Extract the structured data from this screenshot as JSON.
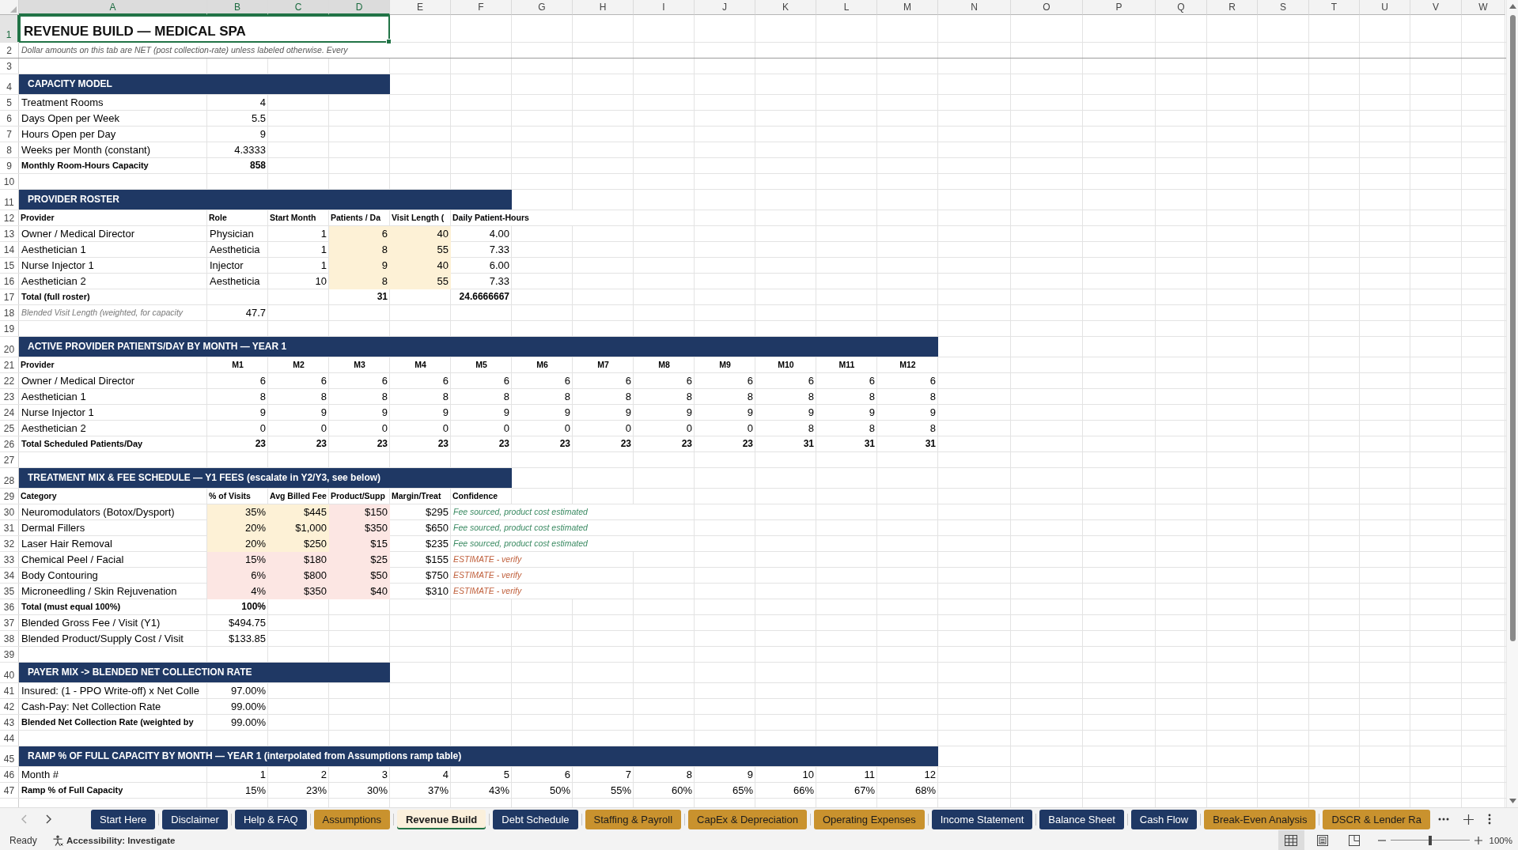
{
  "column_headers": [
    {
      "label": "A",
      "selected": true
    },
    {
      "label": "B",
      "selected": true
    },
    {
      "label": "C",
      "selected": true
    },
    {
      "label": "D",
      "selected": true
    },
    {
      "label": "E",
      "selected": false
    },
    {
      "label": "F",
      "selected": false
    },
    {
      "label": "G",
      "selected": false
    },
    {
      "label": "H",
      "selected": false
    },
    {
      "label": "I",
      "selected": false
    },
    {
      "label": "J",
      "selected": false
    },
    {
      "label": "K",
      "selected": false
    },
    {
      "label": "L",
      "selected": false
    },
    {
      "label": "M",
      "selected": false
    },
    {
      "label": "N",
      "selected": false
    },
    {
      "label": "O",
      "selected": false
    },
    {
      "label": "P",
      "selected": false
    },
    {
      "label": "Q",
      "selected": false
    },
    {
      "label": "R",
      "selected": false
    },
    {
      "label": "S",
      "selected": false
    },
    {
      "label": "T",
      "selected": false
    },
    {
      "label": "U",
      "selected": false
    },
    {
      "label": "V",
      "selected": false
    },
    {
      "label": "W",
      "selected": false
    }
  ],
  "rows": [
    {
      "number": "1",
      "selected": true,
      "kind": "title",
      "cells": [
        "REVENUE BUILD — MEDICAL SPA"
      ]
    },
    {
      "number": "2",
      "selected": false,
      "kind": "note",
      "cells": [
        "Dollar amounts on this tab are NET (post collection-rate) unless labeled otherwise. Every"
      ]
    },
    {
      "number": "3",
      "selected": false,
      "kind": "blank"
    },
    {
      "number": "4",
      "selected": false,
      "kind": "section",
      "cells": [
        "CAPACITY MODEL"
      ]
    },
    {
      "number": "5",
      "selected": false,
      "kind": "data",
      "cells": [
        "Treatment Rooms",
        "4"
      ]
    },
    {
      "number": "6",
      "selected": false,
      "kind": "data",
      "cells": [
        "Days Open per Week",
        "5.5"
      ]
    },
    {
      "number": "7",
      "selected": false,
      "kind": "data",
      "cells": [
        "Hours Open per Day",
        "9"
      ]
    },
    {
      "number": "8",
      "selected": false,
      "kind": "data",
      "cells": [
        "Weeks per Month (constant)",
        "4.3333"
      ]
    },
    {
      "number": "9",
      "selected": false,
      "kind": "total",
      "cells": [
        "Monthly Room-Hours Capacity",
        "858"
      ]
    },
    {
      "number": "10",
      "selected": false,
      "kind": "blank"
    },
    {
      "number": "11",
      "selected": false,
      "kind": "section",
      "cells": [
        "PROVIDER ROSTER"
      ]
    },
    {
      "number": "12",
      "selected": false,
      "kind": "header",
      "cells": [
        "Provider",
        "Role",
        "Start Month",
        "Patients / Da",
        "Visit Length (",
        "Daily Patient-Hours"
      ]
    },
    {
      "number": "13",
      "selected": false,
      "kind": "roster",
      "cells": [
        "Owner / Medical Director",
        "Physician",
        "1",
        "6",
        "40",
        "4.00"
      ]
    },
    {
      "number": "14",
      "selected": false,
      "kind": "roster",
      "cells": [
        "Aesthetician 1",
        "Aestheticia",
        "1",
        "8",
        "55",
        "7.33"
      ]
    },
    {
      "number": "15",
      "selected": false,
      "kind": "roster",
      "cells": [
        "Nurse Injector 1",
        "Injector",
        "1",
        "9",
        "40",
        "6.00"
      ]
    },
    {
      "number": "16",
      "selected": false,
      "kind": "roster",
      "cells": [
        "Aesthetician 2",
        "Aestheticia",
        "10",
        "8",
        "55",
        "7.33"
      ]
    },
    {
      "number": "17",
      "selected": false,
      "kind": "total",
      "cells": [
        "Total (full roster)",
        null,
        null,
        "31",
        null,
        "24.6666667"
      ]
    },
    {
      "number": "18",
      "selected": false,
      "kind": "aside",
      "cells": [
        "Blended Visit Length (weighted, for capacity",
        "47.7"
      ]
    },
    {
      "number": "19",
      "selected": false,
      "kind": "blank"
    },
    {
      "number": "20",
      "selected": false,
      "kind": "section",
      "cells": [
        "ACTIVE PROVIDER PATIENTS/DAY BY MONTH — YEAR 1"
      ]
    },
    {
      "number": "21",
      "selected": false,
      "kind": "month_header",
      "cells": [
        "Provider",
        "M1",
        "M2",
        "M3",
        "M4",
        "M5",
        "M6",
        "M7",
        "M8",
        "M9",
        "M10",
        "M11",
        "M12"
      ]
    },
    {
      "number": "22",
      "selected": false,
      "kind": "data",
      "cells": [
        "Owner / Medical Director",
        "6",
        "6",
        "6",
        "6",
        "6",
        "6",
        "6",
        "6",
        "6",
        "6",
        "6",
        "6"
      ]
    },
    {
      "number": "23",
      "selected": false,
      "kind": "data",
      "cells": [
        "Aesthetician 1",
        "8",
        "8",
        "8",
        "8",
        "8",
        "8",
        "8",
        "8",
        "8",
        "8",
        "8",
        "8"
      ]
    },
    {
      "number": "24",
      "selected": false,
      "kind": "data",
      "cells": [
        "Nurse Injector 1",
        "9",
        "9",
        "9",
        "9",
        "9",
        "9",
        "9",
        "9",
        "9",
        "9",
        "9",
        "9"
      ]
    },
    {
      "number": "25",
      "selected": false,
      "kind": "data",
      "cells": [
        "Aesthetician 2",
        "0",
        "0",
        "0",
        "0",
        "0",
        "0",
        "0",
        "0",
        "0",
        "8",
        "8",
        "8"
      ]
    },
    {
      "number": "26",
      "selected": false,
      "kind": "total",
      "cells": [
        "Total Scheduled Patients/Day",
        "23",
        "23",
        "23",
        "23",
        "23",
        "23",
        "23",
        "23",
        "23",
        "31",
        "31",
        "31"
      ]
    },
    {
      "number": "27",
      "selected": false,
      "kind": "blank"
    },
    {
      "number": "28",
      "selected": false,
      "kind": "section",
      "cells": [
        "TREATMENT MIX & FEE SCHEDULE — Y1 FEES (escalate in Y2/Y3, see below)"
      ]
    },
    {
      "number": "29",
      "selected": false,
      "kind": "header",
      "cells": [
        "Category",
        "% of Visits",
        "Avg Billed Fee",
        "Product/Supp",
        "Margin/Treat",
        "Confidence"
      ]
    },
    {
      "number": "30",
      "selected": false,
      "kind": "treatment",
      "fee_sourced": true,
      "cells": [
        "Neuromodulators (Botox/Dysport)",
        "35%",
        "$445",
        "$150",
        "$295",
        "Fee sourced, product cost estimated"
      ]
    },
    {
      "number": "31",
      "selected": false,
      "kind": "treatment",
      "fee_sourced": true,
      "cells": [
        "Dermal Fillers",
        "20%",
        "$1,000",
        "$350",
        "$650",
        "Fee sourced, product cost estimated"
      ]
    },
    {
      "number": "32",
      "selected": false,
      "kind": "treatment",
      "fee_sourced": true,
      "cells": [
        "Laser Hair Removal",
        "20%",
        "$250",
        "$15",
        "$235",
        "Fee sourced, product cost estimated"
      ]
    },
    {
      "number": "33",
      "selected": false,
      "kind": "treatment",
      "fee_sourced": false,
      "cells": [
        "Chemical Peel / Facial",
        "15%",
        "$180",
        "$25",
        "$155",
        "ESTIMATE - verify"
      ]
    },
    {
      "number": "34",
      "selected": false,
      "kind": "treatment",
      "fee_sourced": false,
      "cells": [
        "Body Contouring",
        "6%",
        "$800",
        "$50",
        "$750",
        "ESTIMATE - verify"
      ]
    },
    {
      "number": "35",
      "selected": false,
      "kind": "treatment",
      "fee_sourced": false,
      "cells": [
        "Microneedling / Skin Rejuvenation",
        "4%",
        "$350",
        "$40",
        "$310",
        "ESTIMATE - verify"
      ]
    },
    {
      "number": "36",
      "selected": false,
      "kind": "total",
      "cells": [
        "Total (must equal 100%)",
        "100%"
      ]
    },
    {
      "number": "37",
      "selected": false,
      "kind": "data",
      "cells": [
        "Blended Gross Fee / Visit (Y1)",
        "$494.75"
      ]
    },
    {
      "number": "38",
      "selected": false,
      "kind": "data",
      "cells": [
        "Blended Product/Supply Cost / Visit",
        "$133.85"
      ]
    },
    {
      "number": "39",
      "selected": false,
      "kind": "blank"
    },
    {
      "number": "40",
      "selected": false,
      "kind": "section",
      "cells": [
        "PAYER MIX -> BLENDED NET COLLECTION RATE"
      ]
    },
    {
      "number": "41",
      "selected": false,
      "kind": "data",
      "cells": [
        "Insured: (1 - PPO Write-off) x Net Colle",
        "97.00%"
      ]
    },
    {
      "number": "42",
      "selected": false,
      "kind": "data",
      "cells": [
        "Cash-Pay: Net Collection Rate",
        "99.00%"
      ]
    },
    {
      "number": "43",
      "selected": false,
      "kind": "key",
      "cells": [
        "Blended Net Collection Rate (weighted by",
        "99.00%"
      ]
    },
    {
      "number": "44",
      "selected": false,
      "kind": "blank"
    },
    {
      "number": "45",
      "selected": false,
      "kind": "section",
      "cells": [
        "RAMP % OF FULL CAPACITY BY MONTH — YEAR 1 (interpolated from Assumptions ramp table)"
      ]
    },
    {
      "number": "46",
      "selected": false,
      "kind": "data",
      "cells": [
        "Month #",
        "1",
        "2",
        "3",
        "4",
        "5",
        "6",
        "7",
        "8",
        "9",
        "10",
        "11",
        "12"
      ]
    },
    {
      "number": "47",
      "selected": false,
      "kind": "key",
      "cells": [
        "Ramp % of Full Capacity",
        "15%",
        "23%",
        "30%",
        "37%",
        "43%",
        "50%",
        "55%",
        "60%",
        "65%",
        "66%",
        "67%",
        "68%"
      ]
    }
  ],
  "tab_scroll": [
    {
      "kind": "previous",
      "disabled": true
    },
    {
      "kind": "next",
      "disabled": false
    }
  ],
  "tabs": [
    {
      "label": "Start Here",
      "color": "#1f3864",
      "selected": false
    },
    {
      "label": "Disclaimer",
      "color": "#1f3864",
      "selected": false
    },
    {
      "label": "Help & FAQ",
      "color": "#1f3864",
      "selected": false
    },
    {
      "label": "Assumptions",
      "color": "#c9922e",
      "selected": false
    },
    {
      "label": "Revenue Build",
      "color": "#fbf0dc",
      "selected": true
    },
    {
      "label": "Debt Schedule",
      "color": "#1f3864",
      "selected": false
    },
    {
      "label": "Staffing & Payroll",
      "color": "#c9922e",
      "selected": false
    },
    {
      "label": "CapEx & Depreciation",
      "color": "#c9922e",
      "selected": false
    },
    {
      "label": "Operating Expenses",
      "color": "#c9922e",
      "selected": false
    },
    {
      "label": "Income Statement",
      "color": "#1f3864",
      "selected": false
    },
    {
      "label": "Balance Sheet",
      "color": "#1f3864",
      "selected": false
    },
    {
      "label": "Cash Flow",
      "color": "#1f3864",
      "selected": false
    },
    {
      "label": "Break-Even Analysis",
      "color": "#c9922e",
      "selected": false
    },
    {
      "label": "DSCR & Lender Ra",
      "color": "#c9922e",
      "selected": false
    }
  ],
  "status_bar": {
    "mode": "Ready",
    "accessibility": "Accessibility: Investigate",
    "views": [
      {
        "kind": "normal",
        "selected": true
      },
      {
        "kind": "page_layout",
        "selected": false
      },
      {
        "kind": "page_break_preview",
        "selected": false
      }
    ],
    "zoom": {
      "level": 0.5,
      "reading": "100%"
    }
  }
}
